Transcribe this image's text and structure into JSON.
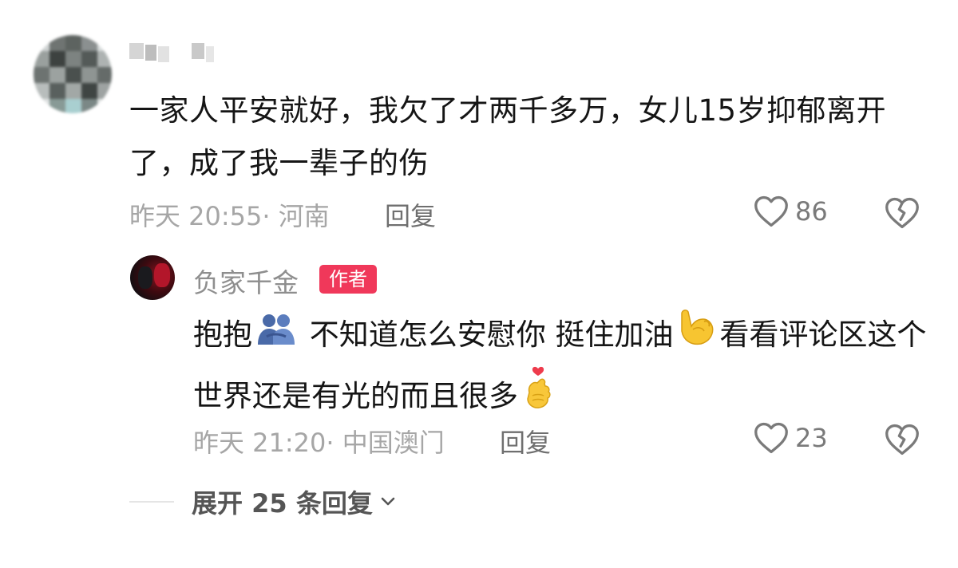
{
  "comment": {
    "text": "一家人平安就好，我欠了才两千多万，女儿15岁抑郁离开了，成了我一辈子的伤",
    "meta": "昨天 20:55· 河南",
    "reply_label": "回复",
    "likes": "86",
    "like_icon": "heart-outline-icon",
    "dislike_icon": "broken-heart-icon"
  },
  "reply": {
    "username": "负家千金",
    "badge": "作者",
    "text_part1": "抱抱",
    "emoji1": "people-hugging-emoji",
    "text_part2": " 不知道怎么安慰你  挺住加油",
    "emoji2": "flexed-biceps-emoji",
    "text_part3": "看看评论区这个世界还是有光的而且很多",
    "emoji3": "hand-with-index-finger-and-thumb-crossed-emoji",
    "meta": "昨天 21:20· 中国澳门",
    "reply_label": "回复",
    "likes": "23"
  },
  "expand": {
    "label": "展开 25 条回复"
  },
  "colors": {
    "badge": "#f0385a",
    "meta_text": "#a6a6a6",
    "body_text": "#151515"
  }
}
